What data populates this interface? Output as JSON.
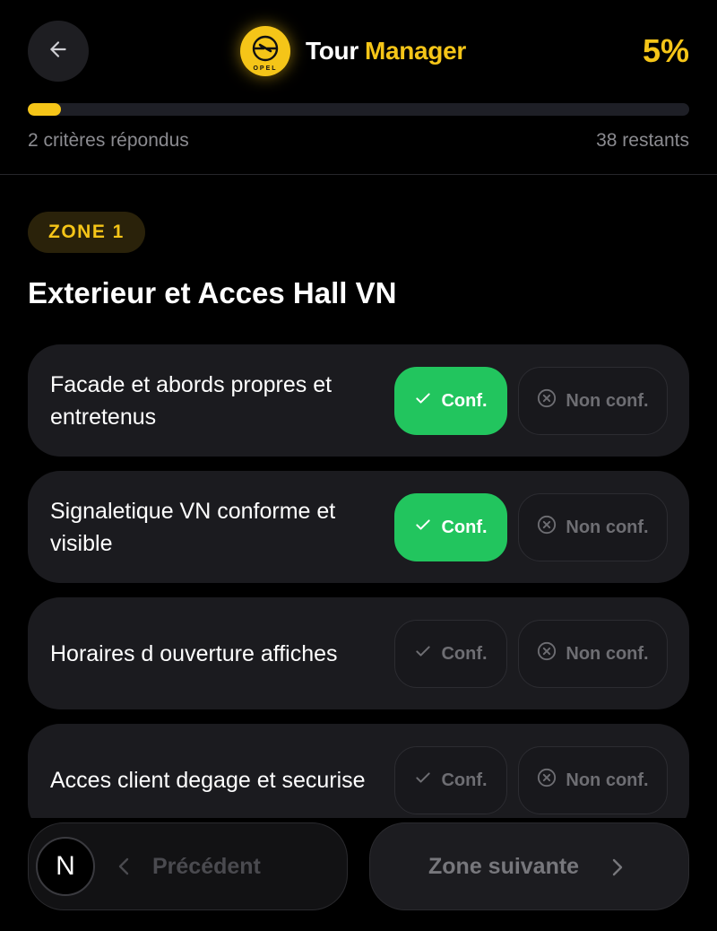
{
  "header": {
    "back_icon": "arrow-left-icon",
    "logo_text": "OPEL",
    "brand_word1": "Tour",
    "brand_word2": "Manager",
    "percent_label": "5%",
    "progress_fraction": 0.05,
    "answered_label": "2 critères répondus",
    "remaining_label": "38 restants"
  },
  "zone": {
    "badge": "ZONE 1",
    "title": "Exterieur et Acces Hall VN"
  },
  "criteria": [
    {
      "label": "Facade et abords propres et entretenus",
      "state": "conf"
    },
    {
      "label": "Signaletique VN conforme et visible",
      "state": "conf"
    },
    {
      "label": "Horaires d ouverture affiches",
      "state": "none"
    },
    {
      "label": "Acces client degage et securise",
      "state": "none"
    }
  ],
  "buttons": {
    "conf_label": "Conf.",
    "non_conf_label": "Non conf.",
    "conf_icon": "check-icon",
    "non_conf_icon": "circle-x-icon"
  },
  "footer": {
    "avatar_letter": "N",
    "prev_label": "Précédent",
    "next_label": "Zone suivante"
  },
  "colors": {
    "accent": "#f5c518",
    "success": "#22c55e",
    "background": "#000000",
    "card": "#1b1b1f"
  }
}
